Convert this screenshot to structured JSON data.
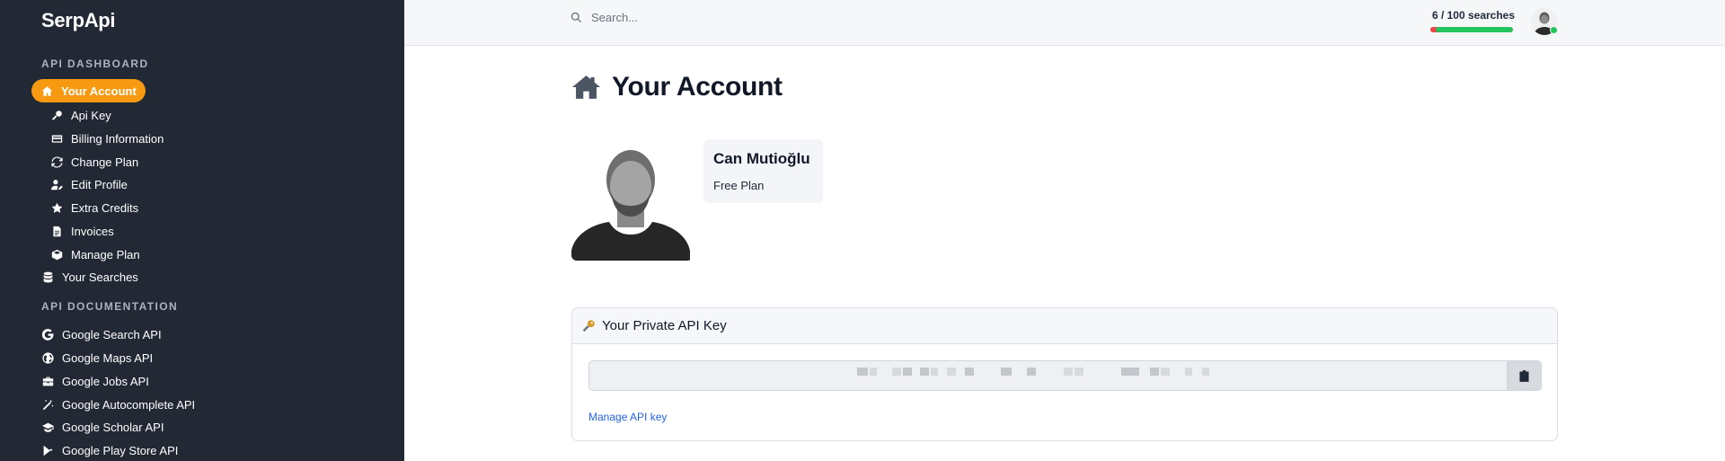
{
  "brand": {
    "name": "SerpApi"
  },
  "sidebar": {
    "dashboard_title": "API DASHBOARD",
    "dashboard_items": [
      {
        "label": "Your Account",
        "icon": "home-icon",
        "active": true
      },
      {
        "label": "Api Key",
        "icon": "key-icon"
      },
      {
        "label": "Billing Information",
        "icon": "credit-card-icon"
      },
      {
        "label": "Change Plan",
        "icon": "sync-icon"
      },
      {
        "label": "Edit Profile",
        "icon": "user-edit-icon"
      },
      {
        "label": "Extra Credits",
        "icon": "star-icon"
      },
      {
        "label": "Invoices",
        "icon": "file-icon"
      },
      {
        "label": "Manage Plan",
        "icon": "box-icon"
      },
      {
        "label": "Your Searches",
        "icon": "database-icon"
      }
    ],
    "docs_title": "API DOCUMENTATION",
    "docs_items": [
      {
        "label": "Google Search API",
        "icon": "google-icon"
      },
      {
        "label": "Google Maps API",
        "icon": "globe-icon"
      },
      {
        "label": "Google Jobs API",
        "icon": "briefcase-icon"
      },
      {
        "label": "Google Autocomplete API",
        "icon": "magic-wand-icon"
      },
      {
        "label": "Google Scholar API",
        "icon": "graduation-cap-icon"
      },
      {
        "label": "Google Play Store API",
        "icon": "play-store-icon"
      }
    ]
  },
  "header": {
    "search_placeholder": "Search...",
    "usage_text": "6 / 100 searches",
    "usage_fraction": 0.06
  },
  "main": {
    "title": "Your Account",
    "profile": {
      "name": "Can Mutioğlu",
      "plan": "Free Plan"
    },
    "api_key_panel": {
      "title": "Your Private API Key",
      "manage_link": "Manage API key"
    }
  },
  "colors": {
    "sidebar_bg": "#222834",
    "accent": "#f79a12",
    "link": "#2563eb",
    "usage_used": "#ef4444",
    "usage_remaining": "#22c55e"
  }
}
